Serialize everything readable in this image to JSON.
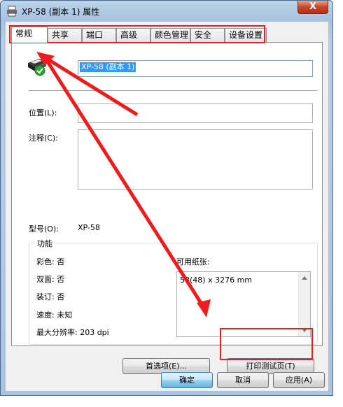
{
  "window": {
    "title": "XP-58 (副本 1) 属性",
    "close_label": "X"
  },
  "tabs": [
    {
      "label": "常规",
      "active": true
    },
    {
      "label": "共享"
    },
    {
      "label": "端口"
    },
    {
      "label": "高级"
    },
    {
      "label": "颜色管理"
    },
    {
      "label": "安全"
    },
    {
      "label": "设备设置"
    }
  ],
  "general": {
    "printer_name": "XP-58 (副本 1)",
    "location_label": "位置(L):",
    "location_value": "",
    "comment_label": "注释(C):",
    "comment_value": "",
    "model_label": "型号(O):",
    "model_value": "XP-58"
  },
  "features": {
    "group_label": "功能",
    "color": "彩色: 否",
    "duplex": "双面: 否",
    "staple": "装订: 否",
    "speed": "速度: 未知",
    "resolution": "最大分辨率: 203 dpi",
    "paper_label": "可用纸张:",
    "paper_items": [
      "58(48) x 3276 mm"
    ]
  },
  "buttons": {
    "preferences": "首选项(E)...",
    "print_test": "打印测试页(T)",
    "ok": "确定",
    "cancel": "取消",
    "apply": "应用(A)"
  },
  "colors": {
    "annotation": "#ee1c1c",
    "selection": "#3399ff"
  },
  "icons": {
    "printer": "printer-icon",
    "status": "green-check-icon"
  }
}
